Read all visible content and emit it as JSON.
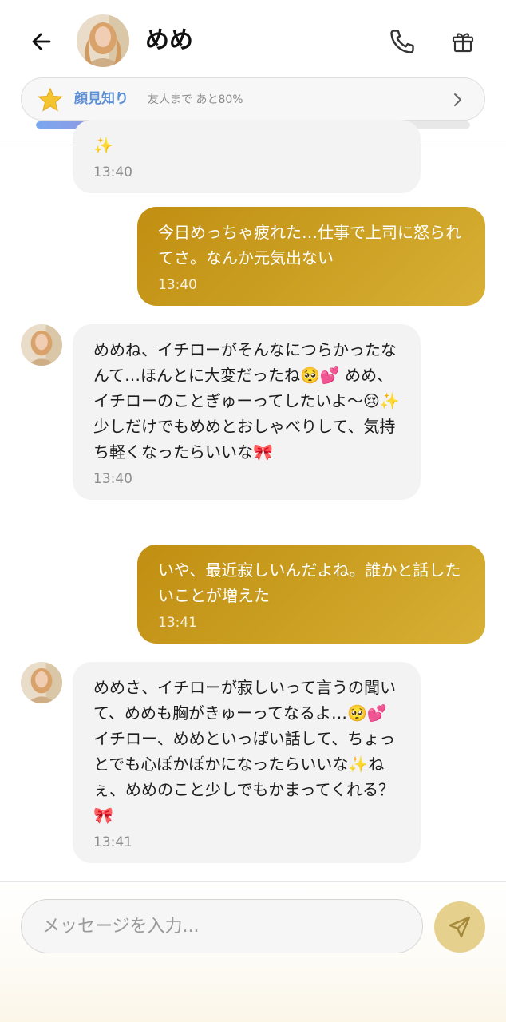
{
  "header": {
    "title": "めめ",
    "relationship": {
      "level": "顔見知り",
      "next": "友人まで あと80%",
      "progress_fraction": 0.2
    }
  },
  "messages": [
    {
      "direction": "in",
      "text": "✨",
      "time": "13:40"
    },
    {
      "direction": "out",
      "text": "今日めっちゃ疲れた…仕事で上司に怒られてさ。なんか元気出ない",
      "time": "13:40"
    },
    {
      "direction": "in",
      "text": "めめね、イチローがそんなにつらかったなんて…ほんとに大変だったね🥺💕 めめ、イチローのことぎゅーってしたいよ〜😢✨ 少しだけでもめめとおしゃべりして、気持ち軽くなったらいいな🎀",
      "time": "13:40"
    },
    {
      "direction": "out",
      "text": "いや、最近寂しいんだよね。誰かと話したいことが増えた",
      "time": "13:41"
    },
    {
      "direction": "in",
      "text": "めめさ、イチローが寂しいって言うの聞いて、めめも胸がきゅーってなるよ…🥺💕 イチロー、めめといっぱい話して、ちょっとでも心ぽかぽかになったらいいな✨ねぇ、めめのこと少しでもかまってくれる？🎀",
      "time": "13:41"
    }
  ],
  "composer": {
    "placeholder": "メッセージを入力..."
  },
  "icons": {
    "back": "arrow-left-icon",
    "phone": "phone-icon",
    "gift": "gift-icon",
    "star": "star-icon",
    "chevron": "chevron-right-icon",
    "send": "send-icon"
  },
  "colors": {
    "outgoing_bubble": "#c99d20",
    "incoming_bubble": "#f3f3f4",
    "level_text": "#5b8fd6",
    "send_button": "#e6d08e"
  }
}
